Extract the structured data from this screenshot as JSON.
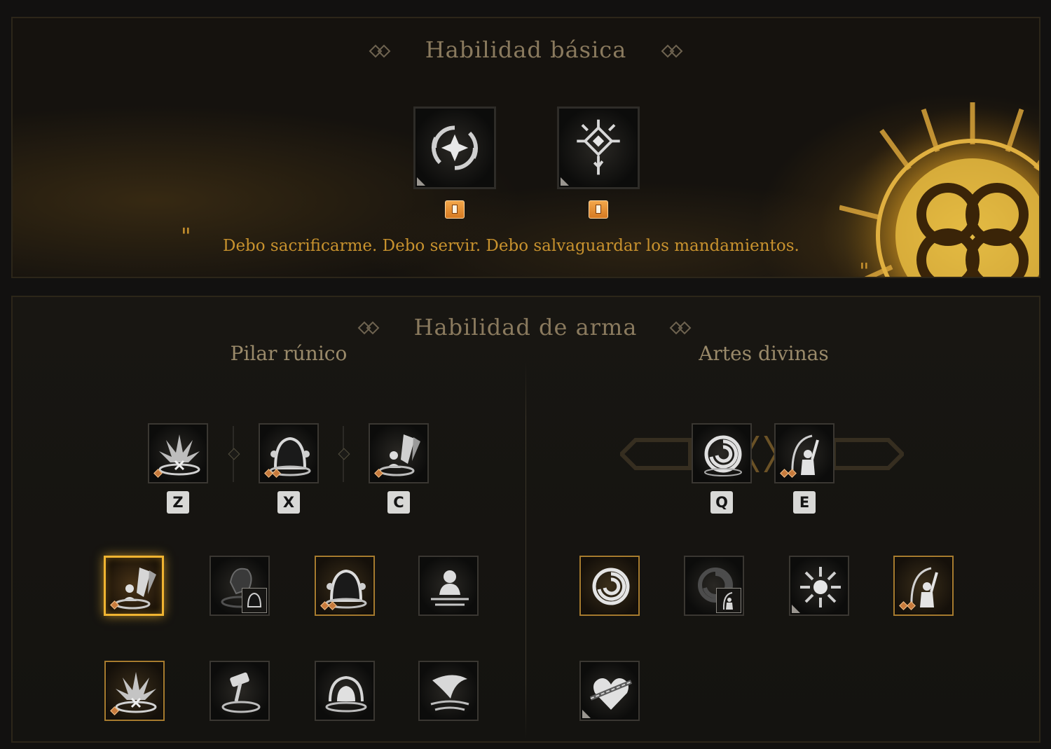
{
  "basic_section": {
    "title": "Habilidad básica",
    "quote_open": "\"",
    "quote": "Debo sacrificarme. Debo servir. Debo salvaguardar los mandamientos.",
    "quote_close": "\"",
    "skills": [
      {
        "icon": "vortex-star-icon"
      },
      {
        "icon": "rune-crystal-icon"
      }
    ]
  },
  "weapon_section": {
    "title": "Habilidad de arma",
    "left_title": "Pilar rúnico",
    "right_title": "Artes divinas",
    "left_equipped_keys": [
      "Z",
      "X",
      "C"
    ],
    "right_equipped_keys": [
      "Q",
      "E"
    ]
  },
  "colors": {
    "accent_gold": "#f0b431",
    "quote_gold": "#c8922e",
    "title_brown": "#8a7a5e",
    "lock_orange": "#d67a22"
  }
}
